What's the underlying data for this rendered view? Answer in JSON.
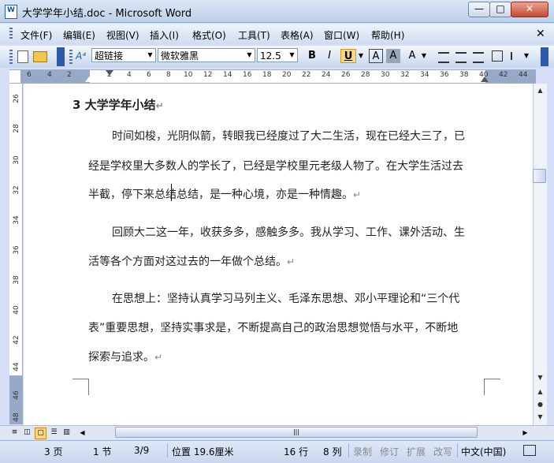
{
  "window": {
    "title": "大学学年小结.doc - Microsoft Word",
    "min_glyph": "—",
    "max_glyph": "□",
    "close_glyph": "✕"
  },
  "menu": {
    "items": [
      "文件(F)",
      "编辑(E)",
      "视图(V)",
      "插入(I)",
      "格式(O)",
      "工具(T)",
      "表格(A)",
      "窗口(W)",
      "帮助(H)"
    ],
    "close_glyph": "✕"
  },
  "toolbar": {
    "style": "超链接",
    "font": "微软雅黑",
    "size": "12.5",
    "bold": "B",
    "italic": "I",
    "underline": "U",
    "char_border": "A",
    "char_shade": "A",
    "highlight": "A"
  },
  "ruler": {
    "tab_selector": "L",
    "numbers": [
      "6",
      "4",
      "2",
      "2",
      "4",
      "6",
      "8",
      "10",
      "12",
      "14",
      "16",
      "18",
      "20",
      "22",
      "24",
      "26",
      "28",
      "30",
      "32",
      "34",
      "36",
      "38",
      "40",
      "42",
      "44"
    ]
  },
  "vruler": {
    "numbers": [
      "26",
      "28",
      "30",
      "32",
      "34",
      "36",
      "38",
      "40",
      "42",
      "44",
      "46",
      "48"
    ]
  },
  "document": {
    "heading": "3 大学学年小结",
    "lines": [
      "时间如梭，光阴似箭，转眼我已经度过了大二生活，现在已经大三了，已",
      "经是学校里大多数人的学长了，已经是学校里元老级人物了。在大学生活过去",
      "半截，停下来总结总结，是一种心境，亦是一种情趣。",
      "回顾大二这一年，收获多多，感触多多。我从学习、工作、课外活动、生",
      "活等各个方面对这过去的一年做个总结。",
      "在思想上：坚持认真学习马列主义、毛泽东思想、邓小平理论和“三个代",
      "表”重要思想，坚持实事求是，不断提高自己的政治思想觉悟与水平，不断地",
      "探索与追求。"
    ],
    "pilcrow": "↵"
  },
  "status": {
    "page": "3 页",
    "section": "1 节",
    "page_of": "3/9",
    "position": "位置 19.6厘米",
    "line": "16 行",
    "column": "8 列",
    "rec": "录制",
    "trk": "修订",
    "ext": "扩展",
    "ovr": "改写",
    "language": "中文(中国)"
  },
  "colors": {
    "accent": "#2c5aa8",
    "underline_active": "#f8d787"
  }
}
